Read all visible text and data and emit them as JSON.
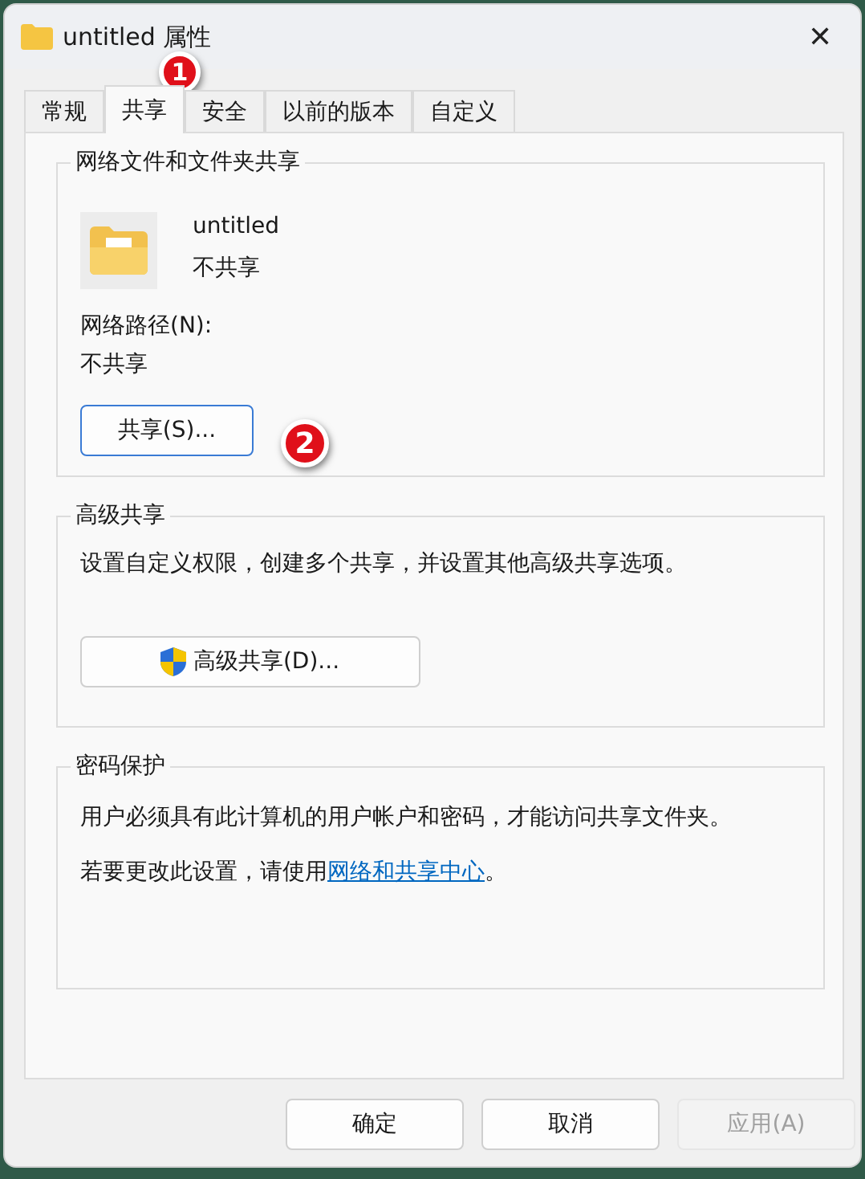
{
  "window": {
    "title": "untitled 属性",
    "close": "✕"
  },
  "tabs": [
    {
      "label": "常规",
      "selected": false
    },
    {
      "label": "共享",
      "selected": true
    },
    {
      "label": "安全",
      "selected": false
    },
    {
      "label": "以前的版本",
      "selected": false
    },
    {
      "label": "自定义",
      "selected": false
    }
  ],
  "network_sharing": {
    "heading": "网络文件和文件夹共享",
    "folder_name": "untitled",
    "folder_status": "不共享",
    "path_label": "网络路径(N):",
    "path_value": "不共享",
    "share_button": "共享(S)..."
  },
  "advanced_sharing": {
    "heading": "高级共享",
    "description": "设置自定义权限，创建多个共享，并设置其他高级共享选项。",
    "button": "高级共享(D)..."
  },
  "password_protection": {
    "heading": "密码保护",
    "text_1": "用户必须具有此计算机的用户帐户和密码，才能访问共享文件夹。",
    "text_2_before": "若要更改此设置，请使用",
    "link": "网络和共享中心",
    "text_2_after": "。"
  },
  "buttons": [
    {
      "label": "确定",
      "disabled": false
    },
    {
      "label": "取消",
      "disabled": false
    },
    {
      "label": "应用(A)",
      "disabled": true
    }
  ],
  "annotations": [
    "1",
    "2"
  ]
}
